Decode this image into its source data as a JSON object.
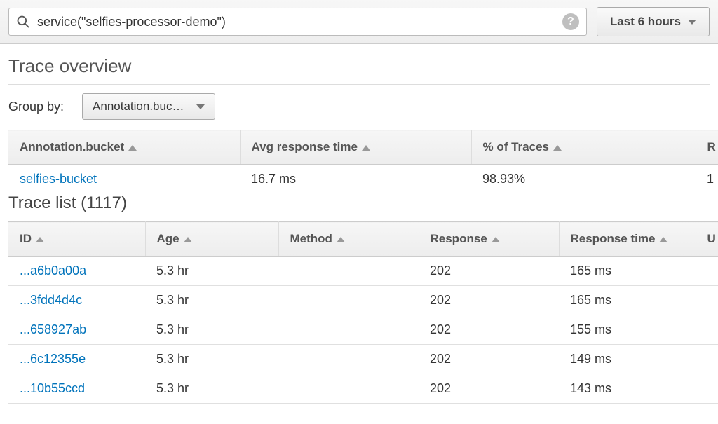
{
  "search": {
    "value": "service(\"selfies-processor-demo\")"
  },
  "time_range": {
    "label": "Last 6 hours"
  },
  "overview": {
    "title": "Trace overview",
    "group_by_label": "Group by:",
    "group_by_value": "Annotation.buc…",
    "columns": {
      "c1": "Annotation.bucket",
      "c2": "Avg response time",
      "c3": "% of Traces",
      "c4": "R"
    },
    "row": {
      "bucket": "selfies-bucket",
      "avg_response": "16.7 ms",
      "pct_traces": "98.93%",
      "trailing": "1"
    }
  },
  "list": {
    "title": "Trace list (1117)",
    "columns": {
      "id": "ID",
      "age": "Age",
      "method": "Method",
      "response": "Response",
      "response_time": "Response time",
      "trailing": "U"
    },
    "rows": [
      {
        "id": "...a6b0a00a",
        "age": "5.3 hr",
        "method": "",
        "response": "202",
        "response_time": "165 ms"
      },
      {
        "id": "...3fdd4d4c",
        "age": "5.3 hr",
        "method": "",
        "response": "202",
        "response_time": "165 ms"
      },
      {
        "id": "...658927ab",
        "age": "5.3 hr",
        "method": "",
        "response": "202",
        "response_time": "155 ms"
      },
      {
        "id": "...6c12355e",
        "age": "5.3 hr",
        "method": "",
        "response": "202",
        "response_time": "149 ms"
      },
      {
        "id": "...10b55ccd",
        "age": "5.3 hr",
        "method": "",
        "response": "202",
        "response_time": "143 ms"
      }
    ]
  }
}
